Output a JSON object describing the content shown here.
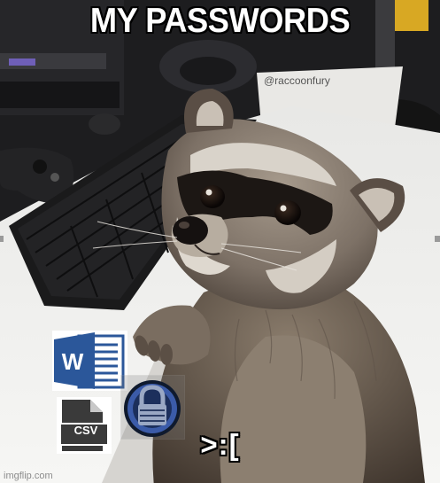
{
  "meme": {
    "top_caption": "MY PASSWORDS",
    "bottom_caption": ">:[",
    "photo_handle": "@raccoonfury",
    "watermark": "imgflip.com"
  },
  "icons": {
    "word": {
      "name": "word-document-icon",
      "letter": "W",
      "color": "#2b579a"
    },
    "csv": {
      "name": "csv-file-icon",
      "label": "CSV",
      "color": "#3a3a3a"
    },
    "keepass": {
      "name": "keepass-icon",
      "color": "#3b5ba8"
    }
  }
}
